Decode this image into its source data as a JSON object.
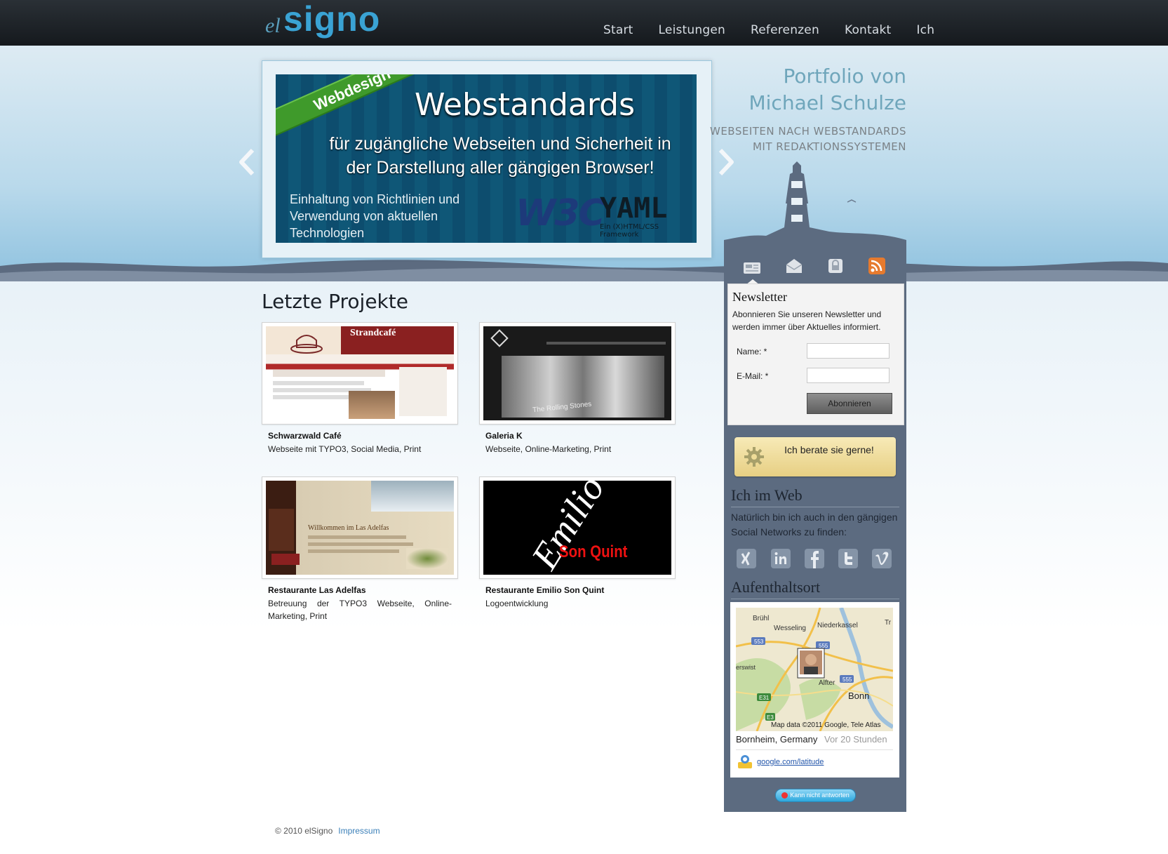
{
  "brand": {
    "logo_el": "el",
    "logo_signo": "signo"
  },
  "nav": {
    "items": [
      "Start",
      "Leistungen",
      "Referenzen",
      "Kontakt",
      "Ich"
    ],
    "active": "Start"
  },
  "slider": {
    "ribbon": "Webdesign",
    "title": "Webstandards",
    "subtitle": "für zugängliche Webseiten und Sicherheit in der Darstellung aller gängigen Browser!",
    "small_text": "Einhaltung von Richtlinien und Verwendung von aktuellen Technologien",
    "logo_w3c": "W3C",
    "logo_yaml": "YAML",
    "logo_yaml_sub": "Ein (X)HTML/CSS Framework"
  },
  "tagline": {
    "line1": "Portfolio von",
    "line2": "Michael Schulze",
    "line3": "WEBSEITEN NACH WEBSTANDARDS",
    "line4": "MIT REDAKTIONSSYSTEMEN"
  },
  "side_icons": [
    "news-icon",
    "mail-icon",
    "lock-icon",
    "rss-icon"
  ],
  "newsletter": {
    "title": "Newsletter",
    "text": "Abonnieren Sie unseren Newsletter und werden immer über Aktuelles informiert.",
    "name_label": "Name: *",
    "email_label": "E-Mail: *",
    "name_value": "",
    "email_value": "",
    "button": "Abonnieren"
  },
  "advice": {
    "text": "Ich berate sie gerne!"
  },
  "web": {
    "title": "Ich im Web",
    "text": "Natürlich bin ich auch in den gängigen Social Networks zu finden:",
    "icons": [
      "xing-icon",
      "linkedin-icon",
      "facebook-icon",
      "twitter-icon",
      "vimeo-icon"
    ]
  },
  "location": {
    "title": "Aufenthaltsort",
    "map_labels": [
      "Brühl",
      "Wesseling",
      "Niederkassel",
      "Tr",
      "553",
      "555",
      "555",
      "erswist",
      "Alfter",
      "Bonn",
      "E31",
      "E3"
    ],
    "map_attribution": "Map data ©2011 Google, Tele Atlas",
    "place": "Bornheim, Germany",
    "ago": "Vor 20 Stunden",
    "link": "google.com/latitude",
    "status": "Kann nicht antworten"
  },
  "projects": {
    "heading": "Letzte Projekte",
    "items": [
      {
        "title": "Schwarzwald Café",
        "desc": "Webseite mit TYPO3, Social Media, Print",
        "shot_text": "Strandcafé"
      },
      {
        "title": "Galeria K",
        "desc": "Webseite, Online-Marketing, Print",
        "shot_text": "The Rolling Stones"
      },
      {
        "title": "Restaurante Las Adelfas",
        "desc": "Betreuung der TYPO3 Webseite, Online-Marketing, Print",
        "shot_text": "Willkommen im Las Adelfas"
      },
      {
        "title": "Restaurante Emilio Son Quint",
        "desc": "Logoentwicklung",
        "shot_text": "Emilio",
        "shot_text2": "Son Quint"
      }
    ]
  },
  "footer": {
    "copyright": "© 2010 elSigno",
    "impressum": "Impressum"
  },
  "colors": {
    "accent": "#3aa3d4",
    "sidebar": "#5c6b80",
    "topbar": "#15191d",
    "link": "#3a7fb8"
  }
}
